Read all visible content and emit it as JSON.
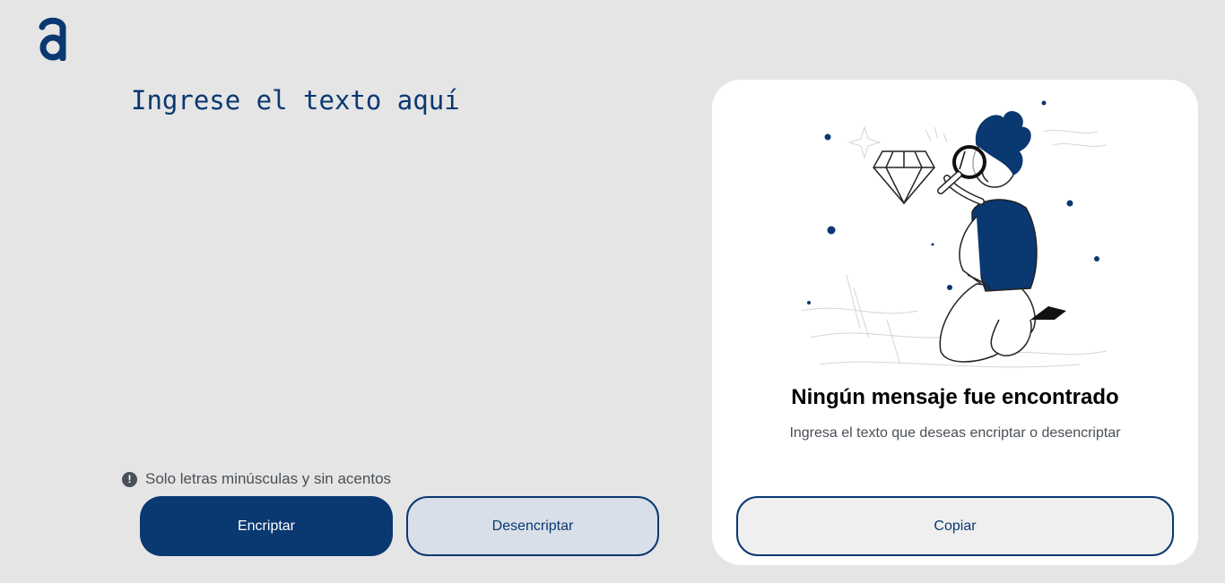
{
  "input": {
    "placeholder": "Ingrese el texto aquí",
    "value": ""
  },
  "hint": {
    "icon": "info-circle-icon",
    "icon_glyph": "!",
    "text": "Solo letras minúsculas y sin acentos"
  },
  "actions": {
    "encrypt_label": "Encriptar",
    "decrypt_label": "Desencriptar"
  },
  "output": {
    "title": "Ningún mensaje fue encontrado",
    "subtitle": "Ingresa el texto que deseas encriptar o desencriptar",
    "copy_label": "Copiar",
    "illustration": "person-with-magnifier-illustration"
  },
  "colors": {
    "primary": "#0a3871",
    "background": "#e5e5e5",
    "secondary_button": "#d8dfe8",
    "panel": "#ffffff",
    "muted_text": "#495057"
  }
}
